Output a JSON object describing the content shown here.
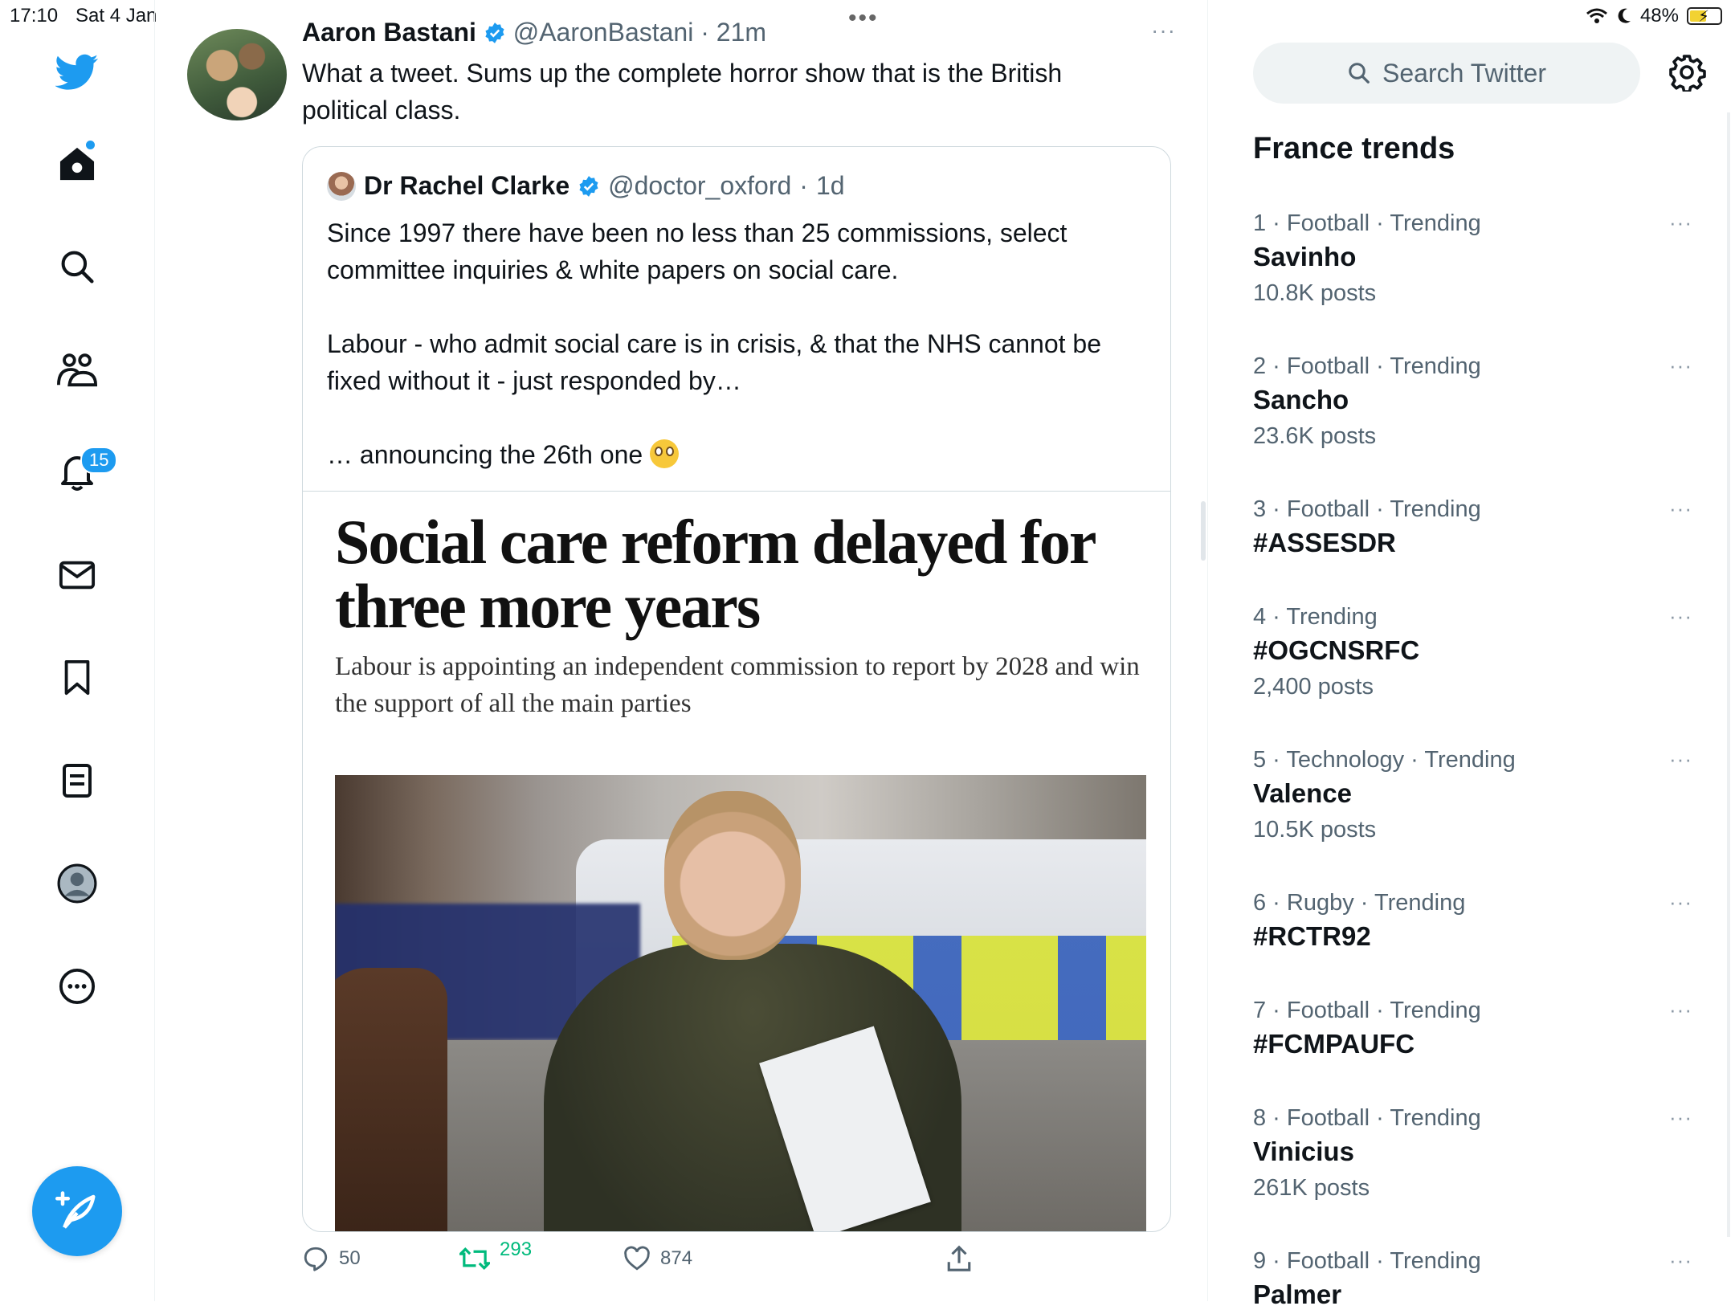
{
  "status_bar": {
    "time": "17:10",
    "date": "Sat 4 Jan",
    "battery": "48%",
    "icons": [
      "wifi-icon",
      "moon-icon",
      "battery-charging-icon"
    ]
  },
  "nav": {
    "icons": [
      "twitter-logo-icon",
      "home-icon",
      "search-icon",
      "communities-icon",
      "notifications-icon",
      "messages-icon",
      "bookmarks-icon",
      "lists-icon",
      "profile-icon",
      "more-icon"
    ],
    "notifications_badge": "15",
    "compose_icon": "compose-feather-icon"
  },
  "tweet": {
    "author_name": "Aaron Bastani",
    "author_handle": "@AaronBastani",
    "separator": "·",
    "time": "21m",
    "text": "What a tweet. Sums up the complete horror show that is the British political class.",
    "more": "···",
    "quoted": {
      "name": "Dr Rachel Clarke",
      "handle": "@doctor_oxford",
      "separator": "·",
      "time": "1d",
      "paragraph1": "Since 1997 there have been no less than 25 commissions, select committee inquiries & white papers on social care.",
      "paragraph2": "Labour - who admit social care is in crisis, & that the NHS cannot be fixed without it - just responded by…",
      "paragraph3": "… announcing the 26th one",
      "emoji": "flushed-face-emoji",
      "headline": "Social care reform delayed for three more years",
      "subheadline": "Labour is appointing an independent commission to report by 2028 and win the support of all the main parties"
    },
    "actions": {
      "replies": "50",
      "retweets": "293",
      "likes": "874"
    }
  },
  "sidebar": {
    "search_placeholder": "Search Twitter",
    "trends_title": "France trends",
    "more": "···",
    "trends": [
      {
        "rank": "1",
        "category": "Football",
        "status": "Trending",
        "topic": "Savinho",
        "posts": "10.8K posts"
      },
      {
        "rank": "2",
        "category": "Football",
        "status": "Trending",
        "topic": "Sancho",
        "posts": "23.6K posts"
      },
      {
        "rank": "3",
        "category": "Football",
        "status": "Trending",
        "topic": "#ASSESDR",
        "posts": ""
      },
      {
        "rank": "4",
        "category": "",
        "status": "Trending",
        "topic": "#OGCNSRFC",
        "posts": "2,400 posts"
      },
      {
        "rank": "5",
        "category": "Technology",
        "status": "Trending",
        "topic": "Valence",
        "posts": "10.5K posts"
      },
      {
        "rank": "6",
        "category": "Rugby",
        "status": "Trending",
        "topic": "#RCTR92",
        "posts": ""
      },
      {
        "rank": "7",
        "category": "Football",
        "status": "Trending",
        "topic": "#FCMPAUFC",
        "posts": ""
      },
      {
        "rank": "8",
        "category": "Football",
        "status": "Trending",
        "topic": "Vinicius",
        "posts": "261K posts"
      },
      {
        "rank": "9",
        "category": "Football",
        "status": "Trending",
        "topic": "Palmer",
        "posts": ""
      }
    ]
  }
}
